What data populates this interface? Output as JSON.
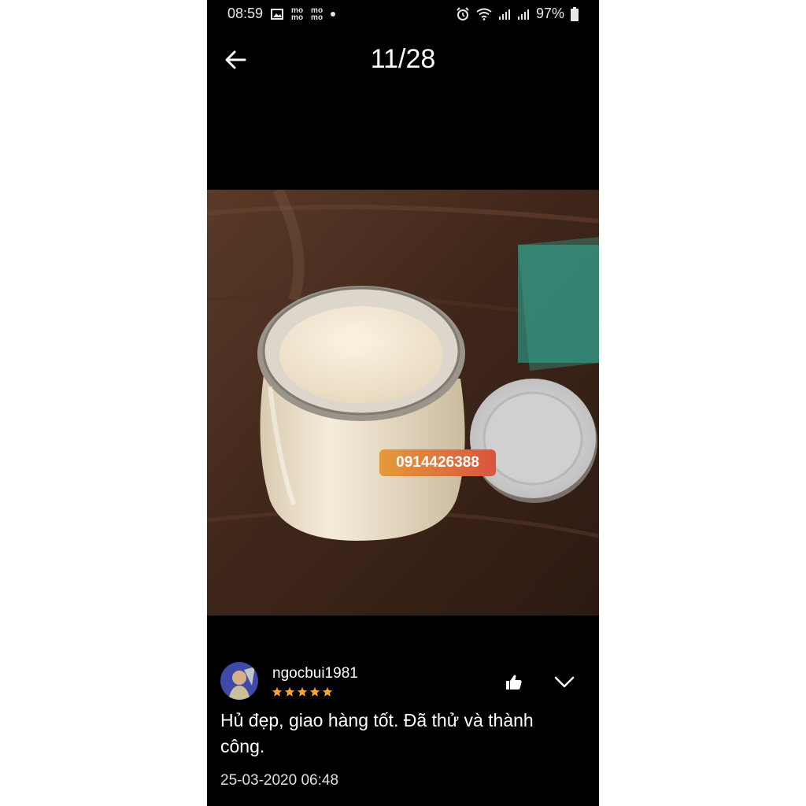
{
  "status_bar": {
    "time": "08:59",
    "app_icons": [
      "image-icon",
      "momo-icon",
      "momo-icon"
    ],
    "momo_label": "mo\nmo",
    "battery": "97%"
  },
  "viewer": {
    "counter": "11/28",
    "watermark_phone": "0914426388"
  },
  "review": {
    "username": "ngocbui1981",
    "rating": 5,
    "comment": "Hủ đẹp, giao hàng tốt. Đã thử và thành công.",
    "date": "25-03-2020 06:48"
  },
  "colors": {
    "background": "#000000",
    "star": "#f5a623",
    "label_gradient_start": "#e59a3a",
    "label_gradient_end": "#d9543f"
  }
}
